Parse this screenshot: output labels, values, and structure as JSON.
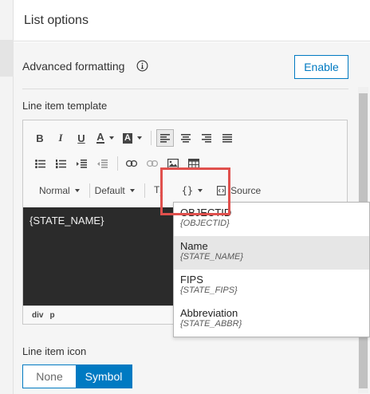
{
  "panel": {
    "title": "List options"
  },
  "advanced": {
    "label": "Advanced formatting",
    "button": "Enable"
  },
  "template": {
    "label": "Line item template",
    "toolbar": {
      "row1": [
        "B",
        "I",
        "U",
        "A",
        "A"
      ],
      "format_combo": "Normal",
      "font_combo": "Default",
      "field_combo": "{}",
      "source_label": "Source"
    },
    "content_text": "{STATE_NAME}",
    "path": [
      "div",
      "p"
    ]
  },
  "fields_dropdown": [
    {
      "label": "OBJECTID",
      "field": "{OBJECTID}"
    },
    {
      "label": "Name",
      "field": "{STATE_NAME}"
    },
    {
      "label": "FIPS",
      "field": "{STATE_FIPS}"
    },
    {
      "label": "Abbreviation",
      "field": "{STATE_ABBR}"
    }
  ],
  "line_item_icon": {
    "label": "Line item icon",
    "options": [
      "None",
      "Symbol"
    ],
    "selected": "Symbol"
  },
  "colors": {
    "accent": "#007ac2",
    "callout": "#e0504d",
    "editor_bg": "#2b2b2b"
  }
}
